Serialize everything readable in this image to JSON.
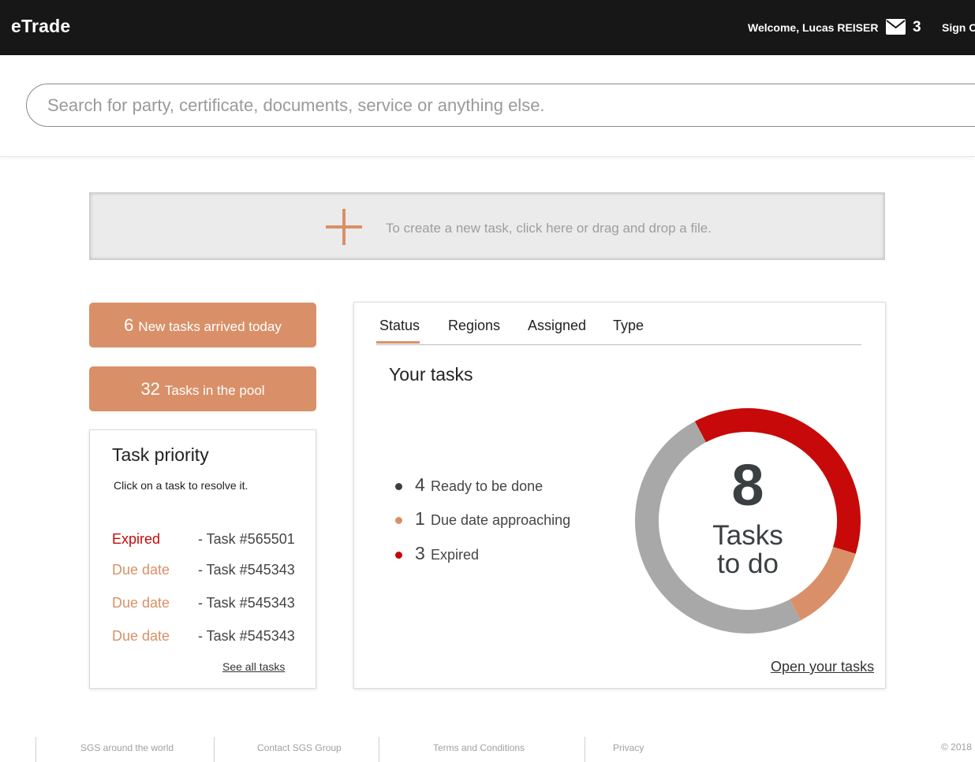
{
  "header": {
    "brand": "eTrade",
    "welcome": "Welcome, Lucas REISER",
    "mail_count": "3",
    "signout": "Sign Out"
  },
  "search": {
    "placeholder": "Search for party, certificate, documents, service or anything else."
  },
  "dropzone": {
    "text": "To create a new task, click here or drag and drop a file."
  },
  "summary": {
    "new_tasks": {
      "count": "6",
      "label": "New tasks arrived today"
    },
    "pool": {
      "count": "32",
      "label": "Tasks in the pool"
    }
  },
  "priority": {
    "title": "Task priority",
    "subtitle": "Click on a task to resolve it.",
    "rows": [
      {
        "label": "Expired",
        "task": "- Task #565501"
      },
      {
        "label": "Due date",
        "task": "- Task #545343"
      },
      {
        "label": "Due date",
        "task": "- Task #545343"
      },
      {
        "label": "Due date",
        "task": "-  Task #545343"
      }
    ],
    "see_all": "See all tasks"
  },
  "panel": {
    "tabs": [
      {
        "label": "Status"
      },
      {
        "label": "Regions"
      },
      {
        "label": "Assigned"
      },
      {
        "label": "Type"
      }
    ],
    "title": "Your tasks",
    "legend": [
      {
        "count": "4",
        "label": "Ready to be done"
      },
      {
        "count": "1",
        "label": "Due date approaching"
      },
      {
        "count": "3",
        "label": "Expired"
      }
    ],
    "total": "8",
    "total_line1": "Tasks",
    "total_line2": "to do",
    "open_link": "Open your tasks"
  },
  "colors": {
    "ready": "#a8a8a8",
    "due": "#d99068",
    "expired": "#c70909",
    "accent": "#d99068",
    "topbar": "#171717"
  },
  "chart_data": {
    "type": "pie",
    "categories": [
      "Ready to be done",
      "Due date approaching",
      "Expired"
    ],
    "values": [
      4,
      1,
      3
    ]
  },
  "footer": {
    "links": [
      "SGS around the world",
      "Contact SGS Group",
      "Terms and Conditions",
      "Privacy"
    ],
    "copyright": "© 2018"
  }
}
